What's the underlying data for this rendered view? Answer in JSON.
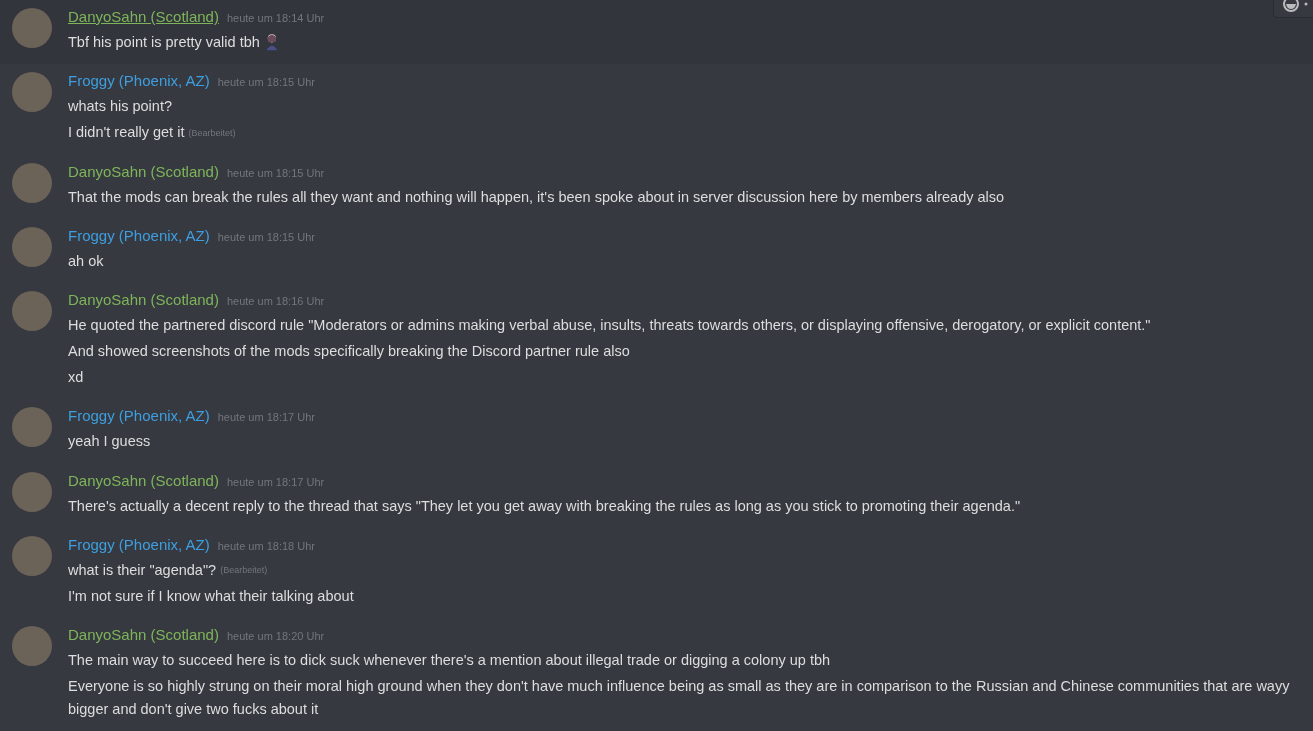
{
  "messages": [
    {
      "author": "DanyoSahn (Scotland)",
      "color": "#7fb55a",
      "timestamp": "heute um 18:14 Uhr",
      "hovered": true,
      "lines": [
        {
          "text": "Tbf his point is pretty valid tbh",
          "has_emoji": true
        }
      ]
    },
    {
      "author": "Froggy (Phoenix, AZ)",
      "color": "#3e9ee0",
      "timestamp": "heute um 18:15 Uhr",
      "hovered": false,
      "lines": [
        {
          "text": "whats his point?"
        },
        {
          "text": "I didn't really get it",
          "edited_label": "(Bearbeitet)"
        }
      ]
    },
    {
      "author": "DanyoSahn (Scotland)",
      "color": "#7fb55a",
      "timestamp": "heute um 18:15 Uhr",
      "hovered": false,
      "lines": [
        {
          "text": "That the mods can break the rules all they want and nothing will happen, it's been spoke about in server discussion here by members already also"
        }
      ]
    },
    {
      "author": "Froggy (Phoenix, AZ)",
      "color": "#3e9ee0",
      "timestamp": "heute um 18:15 Uhr",
      "hovered": false,
      "lines": [
        {
          "text": "ah ok"
        }
      ]
    },
    {
      "author": "DanyoSahn (Scotland)",
      "color": "#7fb55a",
      "timestamp": "heute um 18:16 Uhr",
      "hovered": false,
      "lines": [
        {
          "text": "He quoted the partnered discord rule \"Moderators or admins making verbal abuse, insults, threats towards others, or displaying offensive, derogatory, or explicit content.\""
        },
        {
          "text": "And showed screenshots of the mods specifically breaking the Discord partner rule also"
        },
        {
          "text": "xd"
        }
      ]
    },
    {
      "author": "Froggy (Phoenix, AZ)",
      "color": "#3e9ee0",
      "timestamp": "heute um 18:17 Uhr",
      "hovered": false,
      "lines": [
        {
          "text": "yeah I guess"
        }
      ]
    },
    {
      "author": "DanyoSahn (Scotland)",
      "color": "#7fb55a",
      "timestamp": "heute um 18:17 Uhr",
      "hovered": false,
      "lines": [
        {
          "text": "There's actually a decent reply to the thread that says \"They let you get away with breaking the rules as long as you stick to promoting their agenda.\""
        }
      ]
    },
    {
      "author": "Froggy (Phoenix, AZ)",
      "color": "#3e9ee0",
      "timestamp": "heute um 18:18 Uhr",
      "hovered": false,
      "lines": [
        {
          "text": "what is their \"agenda\"?",
          "edited_label": "(Bearbeitet)"
        },
        {
          "text": "I'm not sure if I know what their talking about"
        }
      ]
    },
    {
      "author": "DanyoSahn (Scotland)",
      "color": "#7fb55a",
      "timestamp": "heute um 18:20 Uhr",
      "hovered": false,
      "lines": [
        {
          "text": "The main way to succeed here is to dick suck whenever there's a mention about illegal trade or digging a colony up tbh"
        },
        {
          "text": "Everyone is so highly strung on their moral high ground when they don't have much influence being as small as they are in comparison to the Russian and Chinese communities that are wayy bigger and don't give two fucks about it"
        }
      ]
    }
  ]
}
